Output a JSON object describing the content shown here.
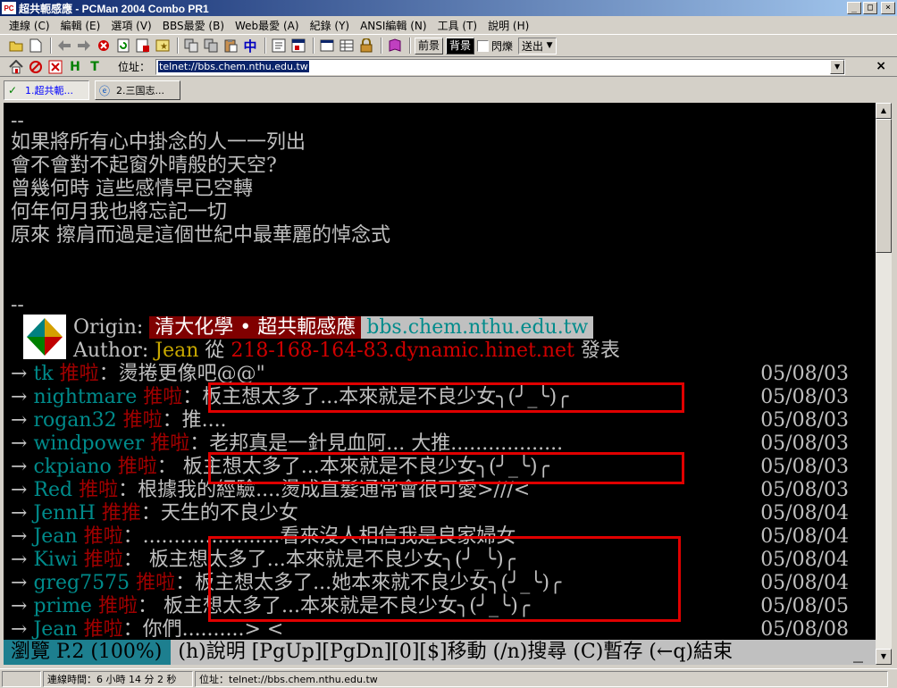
{
  "window": {
    "app_icon_text": "PC",
    "title": "超共軛感應 - PCMan 2004 Combo PR1",
    "controls": [
      "_",
      "□",
      "×"
    ]
  },
  "menu": [
    "連線 (C)",
    "編輯 (E)",
    "選項 (V)",
    "BBS最愛 (B)",
    "Web最愛 (A)",
    "紀錄 (Y)",
    "ANSI編輯 (N)",
    "工具 (T)",
    "說明 (H)"
  ],
  "toolbar": {
    "icons": [
      "open-folder-icon",
      "new-page-icon",
      "back-arrow-icon",
      "forward-arrow-icon",
      "stop-icon",
      "refresh-icon",
      "bookmark-add-icon",
      "star-icon",
      "copy-icon",
      "copy-ansi-icon",
      "paste-icon",
      "chinese-input-icon",
      "settings-icon",
      "window-icon",
      "color-table-icon",
      "table-icon",
      "lock-icon",
      "book-icon"
    ],
    "chinese_input_label": "中",
    "foreground_label": "前景",
    "background_label": "背景",
    "blink_label": "閃爍",
    "send_label": "送出"
  },
  "addressbar": {
    "icons": [
      "home-icon",
      "stop-circle-icon",
      "close-x-icon",
      "h-icon",
      "t-icon"
    ],
    "h_label": "H",
    "t_label": "T",
    "label": "位址：",
    "value": "telnet://bbs.chem.nthu.edu.tw",
    "close_glyph": "×"
  },
  "tabs": [
    {
      "label": "1.超共軛...",
      "icon": "check-icon",
      "active": true
    },
    {
      "label": "2.三国志...",
      "icon": "web-icon",
      "active": false
    }
  ],
  "terminal": {
    "separator1": "--",
    "poem": [
      "如果將所有心中掛念的人一一列出",
      "會不會對不起窗外晴般的天空?",
      "曾幾何時 這些感情早已空轉",
      "何年何月我也將忘記一切",
      "原來 擦肩而過是這個世紀中最華麗的悼念式"
    ],
    "separator2": "--",
    "origin_label": "Origin:",
    "origin_board": "清大化學 • 超共軛感應",
    "origin_host": "bbs.chem.nthu.edu.tw",
    "author_label": "Author:",
    "author_name": "Jean",
    "author_from": "從",
    "author_ip": "218-168-164-83.dynamic.hinet.net",
    "author_post": "發表",
    "pushes": [
      {
        "arrow": "→",
        "user": "tk",
        "tag": "推啦",
        "text": "：燙捲更像吧@@\"",
        "date": "05/08/03"
      },
      {
        "arrow": "→",
        "user": "nightmare",
        "tag": "推啦",
        "text": "：板主想太多了...本來就是不良少女╮(╯_╰)╭",
        "date": "05/08/03"
      },
      {
        "arrow": "→",
        "user": "rogan32",
        "tag": "推啦",
        "text": "：推....",
        "date": "05/08/03"
      },
      {
        "arrow": "→",
        "user": "windpower",
        "tag": "推啦",
        "text": "：老邦真是一針見血阿... 大推..................",
        "date": "05/08/03"
      },
      {
        "arrow": "→",
        "user": "ckpiano",
        "tag": "推啦",
        "text": "： 板主想太多了...本來就是不良少女╮(╯_╰)╭",
        "date": "05/08/03"
      },
      {
        "arrow": "→",
        "user": "Red",
        "tag": "推啦",
        "text": "：根據我的經驗....燙成直髮通常會很可愛>///<",
        "date": "05/08/03"
      },
      {
        "arrow": "→",
        "user": "JennH",
        "tag": "推推",
        "text": "：天生的不良少女",
        "date": "05/08/04"
      },
      {
        "arrow": "→",
        "user": "Jean",
        "tag": "推啦",
        "text": "：......................看來沒人相信我是良家婦女",
        "date": "05/08/04"
      },
      {
        "arrow": "→",
        "user": "Kiwi",
        "tag": "推啦",
        "text": "：  板主想太多了...本來就是不良少女╮(╯_╰)╭",
        "date": "05/08/04"
      },
      {
        "arrow": "→",
        "user": "greg7575",
        "tag": "推啦",
        "text": "：板主想太多了...她本來就不良少女╮(╯_╰)╭",
        "date": "05/08/04"
      },
      {
        "arrow": "→",
        "user": "prime",
        "tag": "推啦",
        "text": "：  板主想太多了...本來就是不良少女╮(╯_╰)╭",
        "date": "05/08/05"
      },
      {
        "arrow": "→",
        "user": "Jean",
        "tag": "推啦",
        "text": "：你們..........> <",
        "date": "05/08/08"
      }
    ],
    "status_mode": "瀏覽 P.2 (100%)",
    "status_keys": "(h)說明 [PgUp][PgDn][0][$]移動 (/n)搜尋 (C)暫存 (←q)結束",
    "cursor": "_",
    "colors": {
      "red_box": "#e00000",
      "mode_bg": "#1d7f8f",
      "origin_bg": "#800000"
    }
  },
  "statusbar": {
    "connection_time": "連線時間：6 小時 14 分 2 秒",
    "address": "位址：telnet://bbs.chem.nthu.edu.tw"
  }
}
